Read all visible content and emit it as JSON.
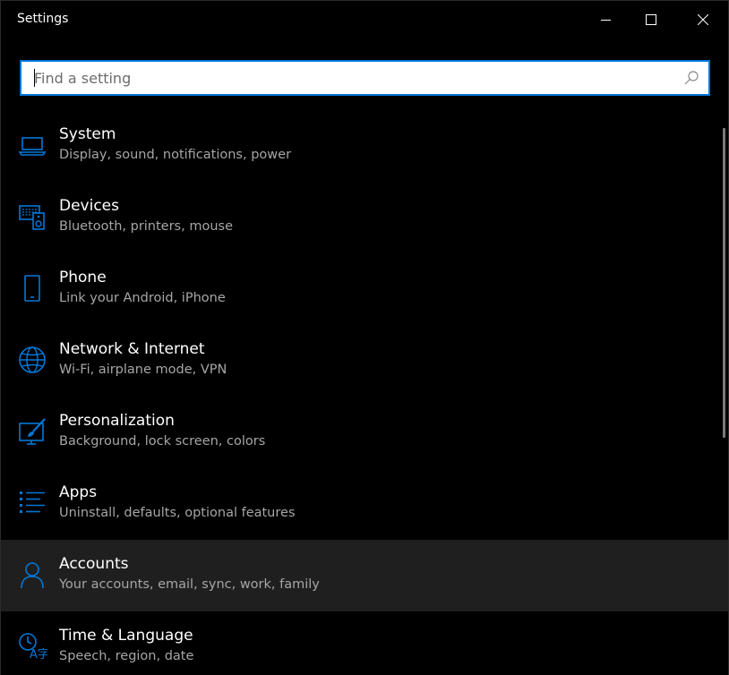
{
  "window": {
    "title": "Settings"
  },
  "search": {
    "placeholder": "Find a setting",
    "value": ""
  },
  "colors": {
    "accent": "#0078d7",
    "background": "#000000",
    "hover": "#1f1f1f",
    "secondary_text": "#a6a6a6"
  },
  "categories": [
    {
      "name": "System",
      "description": "Display, sound, notifications, power",
      "icon": "laptop-icon"
    },
    {
      "name": "Devices",
      "description": "Bluetooth, printers, mouse",
      "icon": "devices-icon"
    },
    {
      "name": "Phone",
      "description": "Link your Android, iPhone",
      "icon": "phone-icon"
    },
    {
      "name": "Network & Internet",
      "description": "Wi-Fi, airplane mode, VPN",
      "icon": "globe-icon"
    },
    {
      "name": "Personalization",
      "description": "Background, lock screen, colors",
      "icon": "paint-icon"
    },
    {
      "name": "Apps",
      "description": "Uninstall, defaults, optional features",
      "icon": "apps-list-icon"
    },
    {
      "name": "Accounts",
      "description": "Your accounts, email, sync, work, family",
      "icon": "person-icon",
      "hovered": true
    },
    {
      "name": "Time & Language",
      "description": "Speech, region, date",
      "icon": "time-language-icon"
    }
  ]
}
